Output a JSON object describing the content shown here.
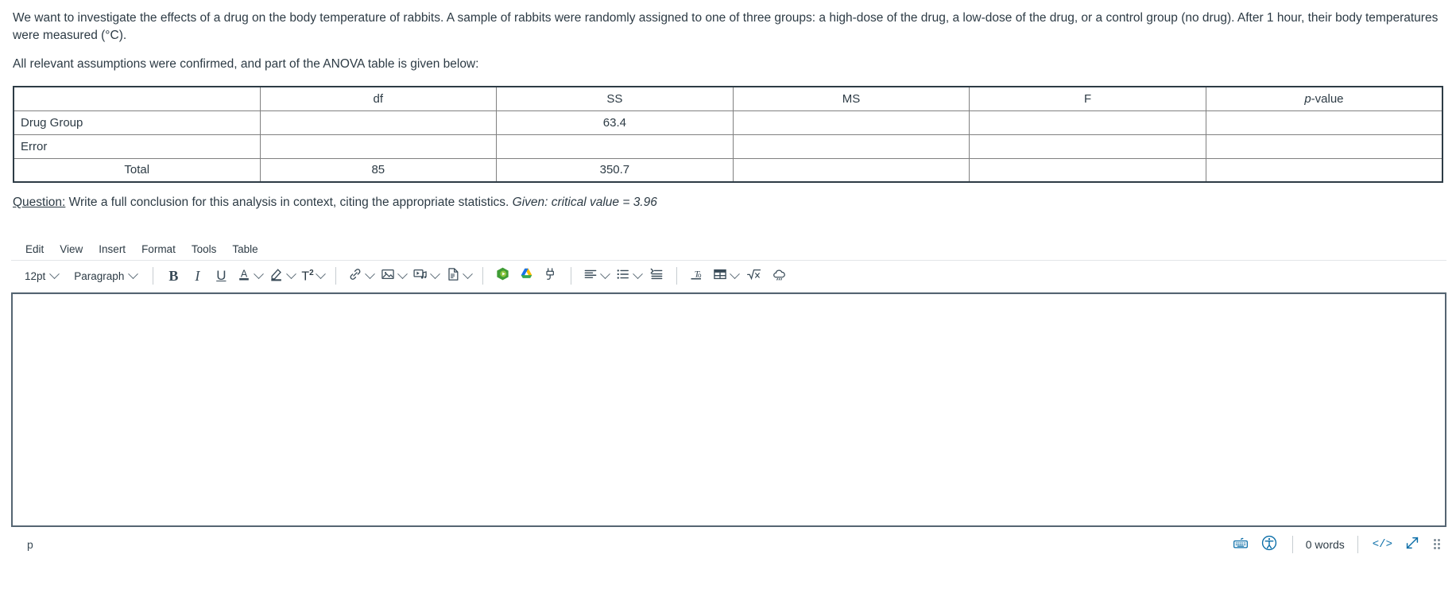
{
  "prompt": {
    "paragraph1": "We want to investigate the effects of a drug on the body temperature of rabbits.  A sample of rabbits were randomly assigned to one of three groups: a high-dose of the drug, a low-dose of the drug, or a control group (no drug).  After 1 hour, their body temperatures were measured (°C).",
    "paragraph2": "All relevant assumptions were confirmed, and part of the ANOVA table is given below:"
  },
  "anova_table": {
    "headers": [
      "",
      "df",
      "SS",
      "MS",
      "F",
      "p-value"
    ],
    "pvalue_italic_prefix": "p",
    "pvalue_suffix": "-value",
    "rows": [
      {
        "label": "Drug Group",
        "df": "",
        "ss": "63.4",
        "ms": "",
        "f": "",
        "p": ""
      },
      {
        "label": "Error",
        "df": "",
        "ss": "",
        "ms": "",
        "f": "",
        "p": ""
      },
      {
        "label": "Total",
        "df": "85",
        "ss": "350.7",
        "ms": "",
        "f": "",
        "p": ""
      }
    ]
  },
  "question": {
    "label": "Question:",
    "text": " Write a full conclusion for this analysis in context, citing the appropriate statistics. ",
    "given": "Given: critical value = 3.96"
  },
  "editor": {
    "menubar": [
      {
        "label": "Edit",
        "name": "menu-edit"
      },
      {
        "label": "View",
        "name": "menu-view"
      },
      {
        "label": "Insert",
        "name": "menu-insert"
      },
      {
        "label": "Format",
        "name": "menu-format"
      },
      {
        "label": "Tools",
        "name": "menu-tools"
      },
      {
        "label": "Table",
        "name": "menu-table"
      }
    ],
    "toolbar": {
      "font_size": "12pt",
      "block_format": "Paragraph",
      "bold": "B",
      "italic": "I",
      "underline": "U",
      "text_color": "A",
      "highlight": "highlighter",
      "superscript": "T",
      "superscript_exp": "2",
      "link": "link-icon",
      "image": "image-icon",
      "media": "media-icon",
      "document": "document-icon",
      "kaltura": "kaltura-icon",
      "google_drive": "google-drive-icon",
      "plugin": "plugin-icon",
      "align": "align-left-icon",
      "list": "bulleted-list-icon",
      "indent": "indent-icon",
      "clear_format": "clear-formatting-icon",
      "table": "table-icon",
      "math": "math-equation-icon",
      "cloud": "cloud-icon"
    },
    "body_content": "",
    "statusbar": {
      "element_path": "p",
      "word_count": "0 words",
      "keyboard_shortcuts": "keyboard-icon",
      "accessibility_checker": "accessibility-icon",
      "html_editor": "</>",
      "fullscreen": "fullscreen-icon",
      "resize_handle": "resize-grip"
    }
  },
  "colors": {
    "text": "#2d3b45",
    "table_border": "#808080",
    "table_outer_border": "#2d3b45",
    "editor_border": "#556572",
    "toolbar_icon": "#394B58",
    "status_icon": "#0b6ea8",
    "kaltura_green": "#2e8b22",
    "drive_blue": "#1a73e8",
    "drive_yellow": "#fbbc04",
    "drive_green": "#34a853"
  }
}
